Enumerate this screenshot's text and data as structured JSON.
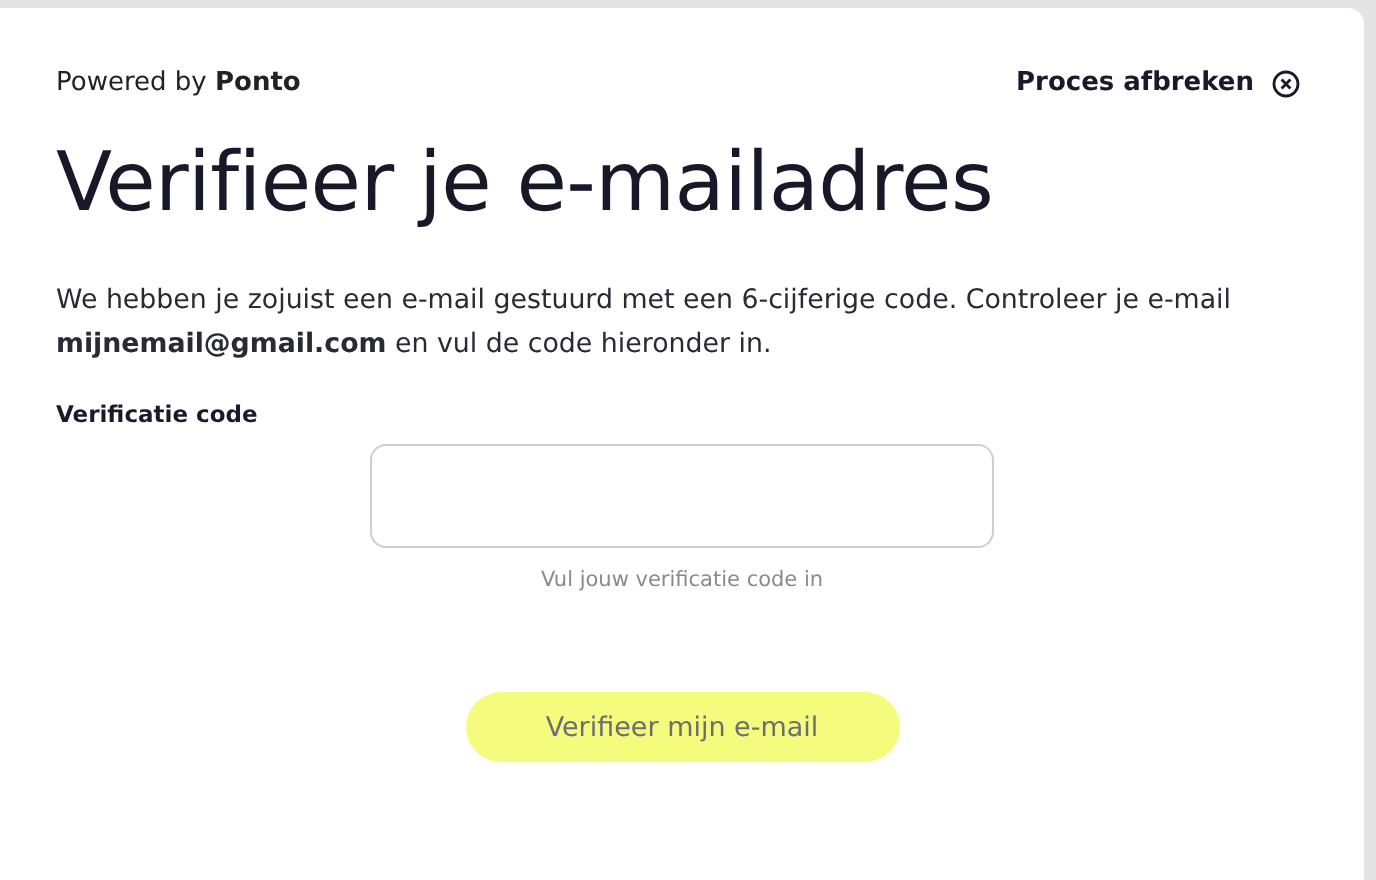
{
  "header": {
    "powered_by": "Powered by **Ponto**",
    "cancel": {
      "label": "Proces afbreken"
    }
  },
  "title": "Verifieer je e-mailadres",
  "description": "We hebben je zojuist een e-mail gestuurd met een 6-cijferige code. Controleer je e-mail **mijnemail@gmail.com** en vul de code hieronder in.",
  "field": {
    "label": "Verificatie code",
    "hint": "Vul jouw verificatie code in"
  },
  "submit": {
    "label": "Verifieer mijn e-mail",
    "disabled": true
  }
}
